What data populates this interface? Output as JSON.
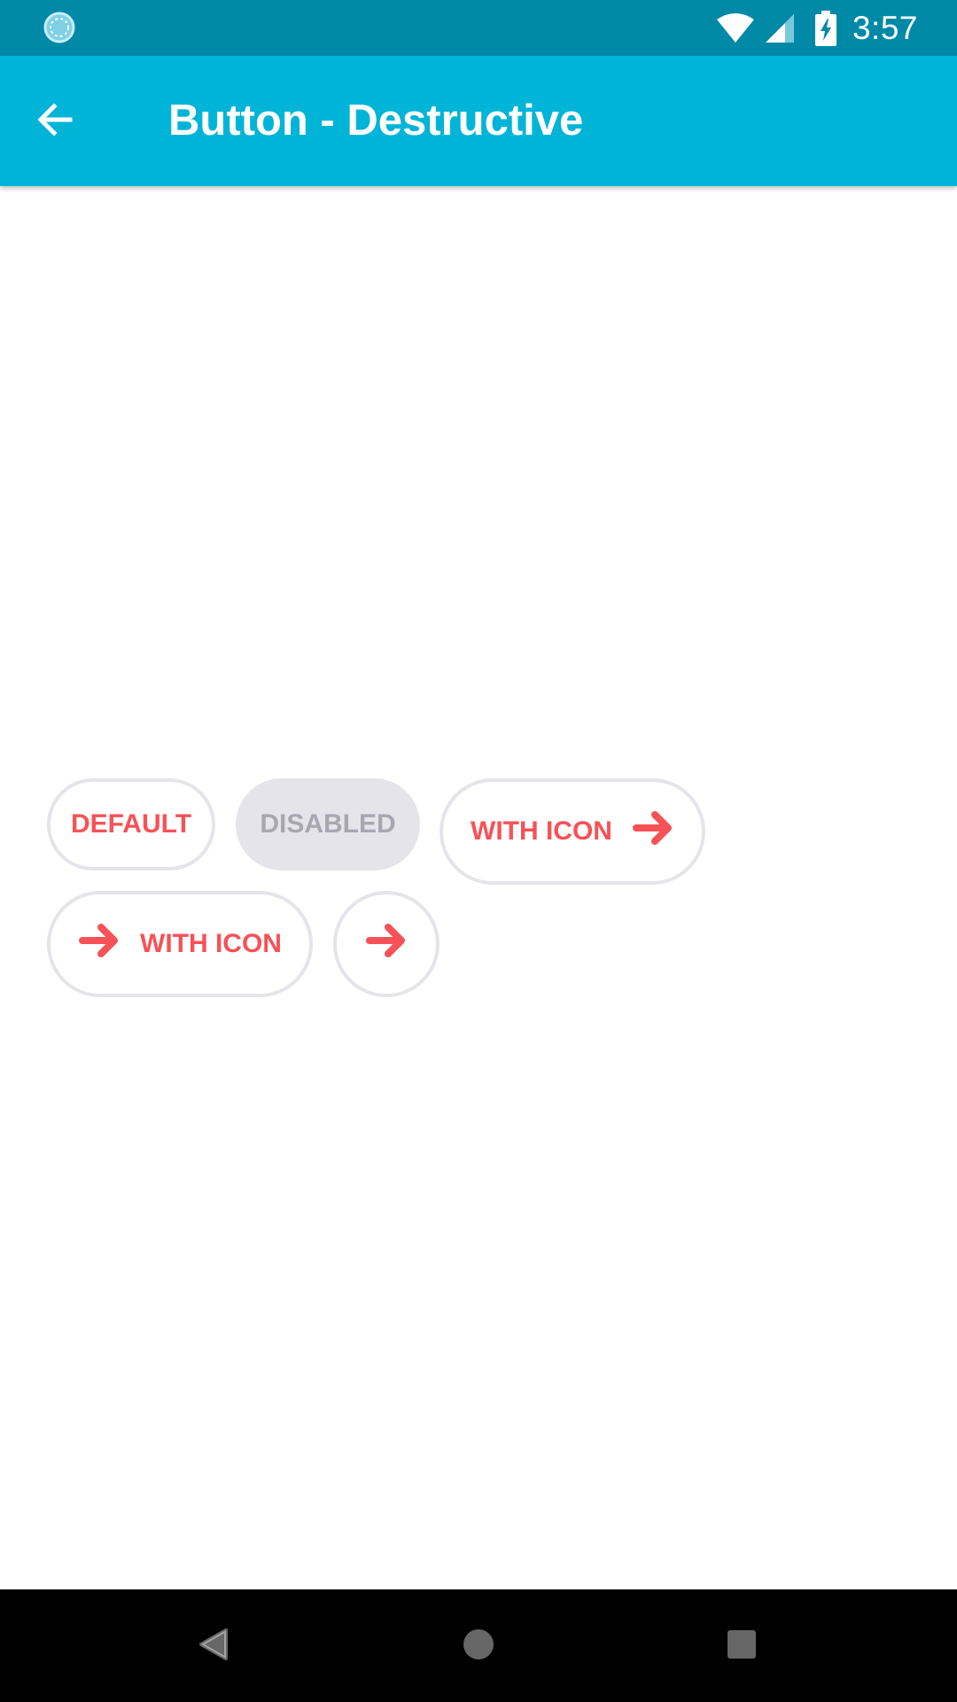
{
  "status_bar": {
    "time": "3:57",
    "left_icon": "loading-spinner-icon",
    "right_icons": [
      "wifi-icon",
      "signal-icon",
      "battery-charging-icon"
    ],
    "color": "#0089a7"
  },
  "app_bar": {
    "title": "Button - Destructive",
    "back_icon": "arrow-left-icon",
    "color": "#00b4d8"
  },
  "buttons": {
    "default_label": "DEFAULT",
    "disabled_label": "DISABLED",
    "with_icon_right_label": "WITH ICON",
    "with_icon_left_label": "WITH ICON",
    "icon_name": "arrow-right-icon",
    "text_color": "#f65257",
    "border_color": "#e5e4ea",
    "disabled_text_color": "#a8a6b2"
  },
  "nav_bar": {
    "back_icon": "nav-back-triangle-icon",
    "home_icon": "nav-home-circle-icon",
    "recents_icon": "nav-recents-square-icon"
  }
}
